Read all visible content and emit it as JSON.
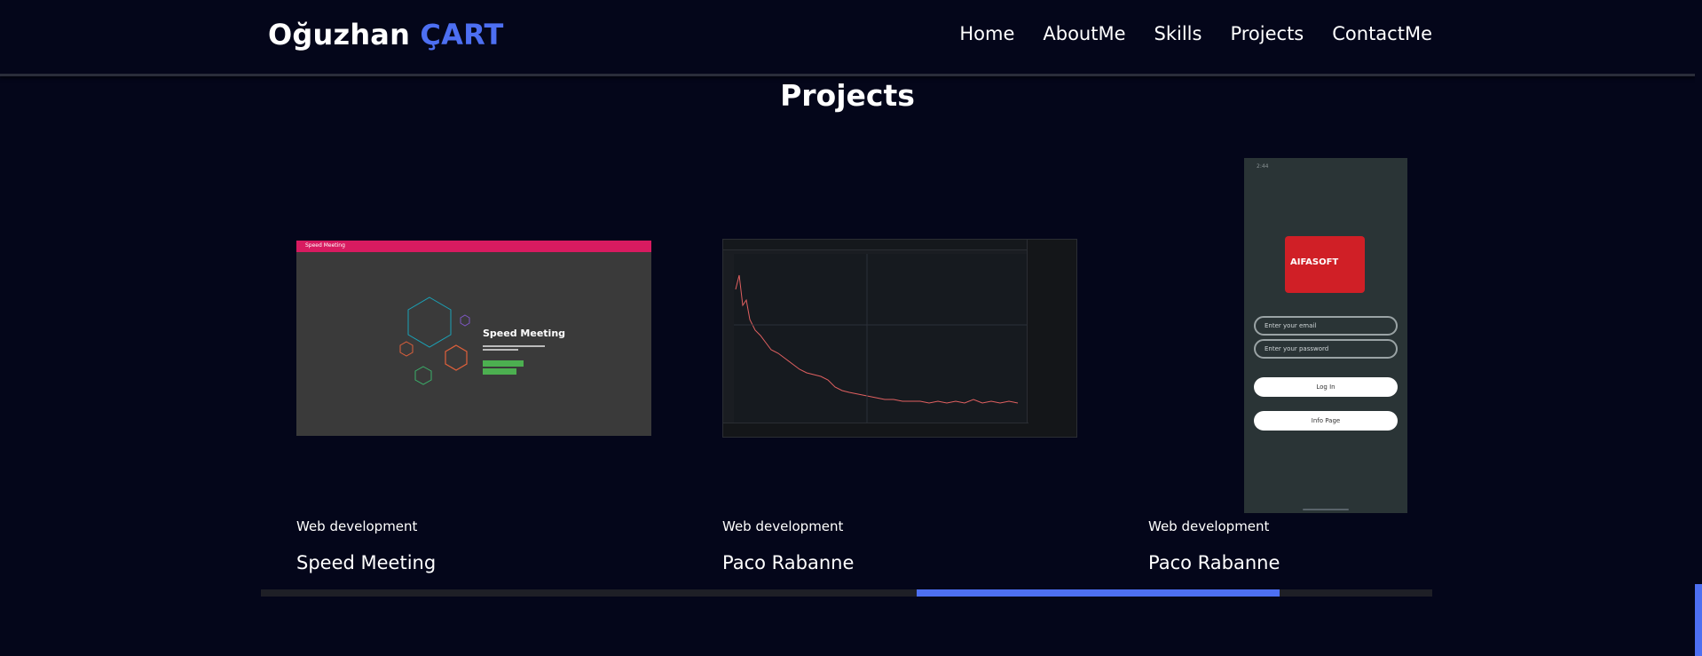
{
  "brand": {
    "first": "Oğuzhan",
    "last": "ÇART",
    "accent_color": "#4d6ff2"
  },
  "nav": [
    {
      "label": "Home"
    },
    {
      "label": "AboutMe"
    },
    {
      "label": "Skills"
    },
    {
      "label": "Projects"
    },
    {
      "label": "ContactMe"
    }
  ],
  "section": {
    "title": "Projects"
  },
  "projects": [
    {
      "category": "Web development",
      "title": "Speed Meeting",
      "thumb": {
        "bar_text": "Speed Meeting",
        "heading": "Speed Meeting"
      }
    },
    {
      "category": "Web development",
      "title": "Paco Rabanne"
    },
    {
      "category": "Web development",
      "title": "Paco Rabanne",
      "thumb": {
        "logo": "AIFASOFT",
        "email_placeholder": "Enter your email",
        "password_placeholder": "Enter your password",
        "login_label": "Log In",
        "info_label": "Info Page"
      }
    }
  ],
  "slider": {
    "progress_fraction": 0.31,
    "progress_start_fraction": 0.56
  }
}
